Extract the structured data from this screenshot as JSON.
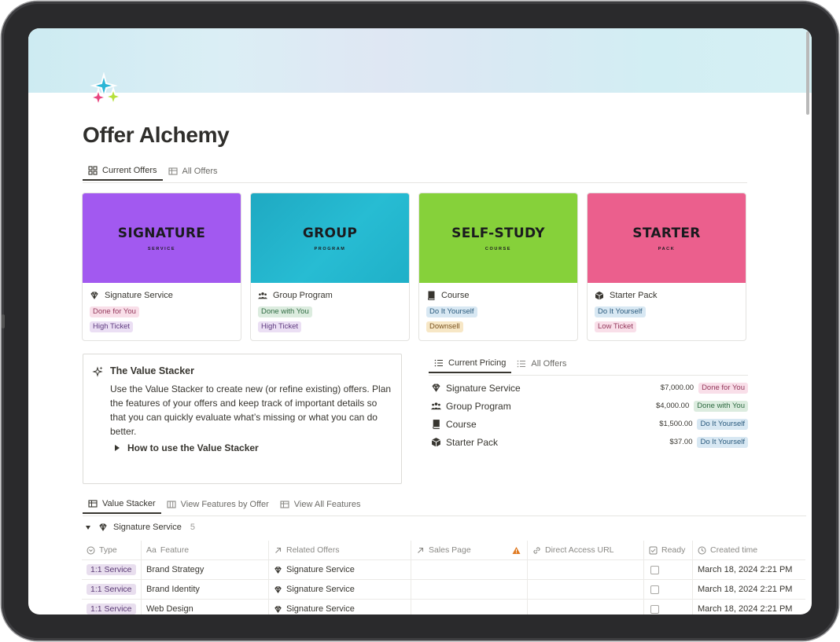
{
  "page": {
    "title": "Offer Alchemy",
    "icon": "sparkles-icon"
  },
  "colors": {
    "purple": "#a259f0",
    "teal": "#22b3c9",
    "green": "#86d13a",
    "pink": "#eb5f8d",
    "tag_pink_bg": "#f9dfe9",
    "tag_pink_fg": "#93385b",
    "tag_purple_bg": "#ebdff4",
    "tag_purple_fg": "#5f3c80",
    "tag_green_bg": "#dcecdf",
    "tag_green_fg": "#2f6b42",
    "tag_blue_bg": "#d8e8f3",
    "tag_blue_fg": "#2a5a7d",
    "tag_yellow_bg": "#f7e7c6",
    "tag_yellow_fg": "#7a5320"
  },
  "gallery_tabs": [
    {
      "label": "Current Offers",
      "icon": "gallery-icon",
      "active": true
    },
    {
      "label": "All Offers",
      "icon": "table-icon",
      "active": false
    }
  ],
  "cards": [
    {
      "big": "SIGNATURE",
      "small": "SERVICE",
      "title": "Signature Service",
      "icon": "gem-icon",
      "tags": [
        "Done for You",
        "High Ticket"
      ]
    },
    {
      "big": "GROUP",
      "small": "PROGRAM",
      "title": "Group Program",
      "icon": "users-icon",
      "tags": [
        "Done with You",
        "High Ticket"
      ]
    },
    {
      "big": "SELF-STUDY",
      "small": "COURSE",
      "title": "Course",
      "icon": "book-icon",
      "tags": [
        "Do It Yourself",
        "Downsell"
      ]
    },
    {
      "big": "STARTER",
      "small": "PACK",
      "title": "Starter Pack",
      "icon": "box-icon",
      "tags": [
        "Do It Yourself",
        "Low Ticket"
      ]
    }
  ],
  "stacker": {
    "title": "The Value Stacker",
    "body": "Use the Value Stacker to create new (or refine existing) offers. Plan the features of your offers and keep track of important details so that you can quickly evaluate what’s missing or what you can do better.",
    "toggle": "How to use the Value Stacker"
  },
  "pricing_tabs": [
    {
      "label": "Current Pricing",
      "icon": "list-icon",
      "active": true
    },
    {
      "label": "All Offers",
      "icon": "list-icon",
      "active": false
    }
  ],
  "pricing": [
    {
      "name": "Signature Service",
      "price": "$7,000.00",
      "tag": "Done for You",
      "icon": "gem-icon"
    },
    {
      "name": "Group Program",
      "price": "$4,000.00",
      "tag": "Done with You",
      "icon": "users-icon"
    },
    {
      "name": "Course",
      "price": "$1,500.00",
      "tag": "Do It Yourself",
      "icon": "book-icon"
    },
    {
      "name": "Starter Pack",
      "price": "$37.00",
      "tag": "Do It Yourself",
      "icon": "box-icon"
    }
  ],
  "table_tabs": [
    {
      "label": "Value Stacker",
      "icon": "table-icon",
      "active": true
    },
    {
      "label": "View Features by Offer",
      "icon": "board-icon",
      "active": false
    },
    {
      "label": "View All Features",
      "icon": "table-icon",
      "active": false
    }
  ],
  "group": {
    "name": "Signature Service",
    "count": "5"
  },
  "columns": [
    {
      "label": "Type",
      "icon": "select-icon"
    },
    {
      "label": "Feature",
      "prefix": "Aa"
    },
    {
      "label": "Related Offers",
      "icon": "arrow-up-right-icon"
    },
    {
      "label": "Sales Page",
      "icon": "arrow-up-right-icon"
    },
    {
      "label": "Direct Access URL",
      "icon": "link-icon"
    },
    {
      "label": "Ready",
      "icon": "checkbox-icon"
    },
    {
      "label": "Created time",
      "icon": "clock-icon"
    }
  ],
  "rows": [
    {
      "type": "1:1 Service",
      "feature": "Brand Strategy",
      "related": "Signature Service",
      "created": "March 18, 2024 2:21 PM"
    },
    {
      "type": "1:1 Service",
      "feature": "Brand Identity",
      "related": "Signature Service",
      "created": "March 18, 2024 2:21 PM"
    },
    {
      "type": "1:1 Service",
      "feature": "Web Design",
      "related": "Signature Service",
      "created": "March 18, 2024 2:21 PM"
    }
  ]
}
